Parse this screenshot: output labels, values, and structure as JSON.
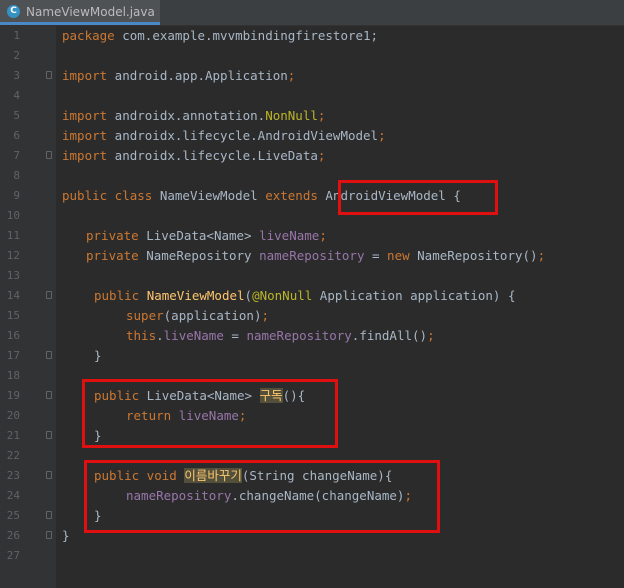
{
  "tab": {
    "icon_letter": "C",
    "label": "NameViewModel.java"
  },
  "lines": {
    "l1": {
      "num": "1",
      "a": "package",
      "b": " com.example.mvvmbindingfirestore1;"
    },
    "l2": {
      "num": "2"
    },
    "l3": {
      "num": "3",
      "a": "import",
      "b": " android.app.Application",
      "c": ";"
    },
    "l4": {
      "num": "4"
    },
    "l5": {
      "num": "5",
      "a": "import",
      "b": " androidx.annotation.",
      "c": "NonNull",
      "d": ";"
    },
    "l6": {
      "num": "6",
      "a": "import",
      "b": " androidx.lifecycle.AndroidViewModel",
      "c": ";"
    },
    "l7": {
      "num": "7",
      "a": "import",
      "b": " androidx.lifecycle.LiveData",
      "c": ";"
    },
    "l8": {
      "num": "8"
    },
    "l9": {
      "num": "9",
      "a": "public class",
      "b": " NameViewModel ",
      "c": "extends",
      "d": " AndroidViewModel {"
    },
    "l10": {
      "num": "10"
    },
    "l11": {
      "num": "11",
      "a": "private",
      "b": " LiveData<Name> ",
      "c": "liveName",
      "d": ";"
    },
    "l12": {
      "num": "12",
      "a": "private",
      "b": " NameRepository ",
      "c": "nameRepository",
      "d": " = ",
      "e": "new",
      "f": " NameRepository()",
      "g": ";"
    },
    "l13": {
      "num": "13"
    },
    "l14": {
      "num": "14",
      "a": "public",
      "b": " ",
      "c": "NameViewModel",
      "d": "(",
      "e": "@NonNull",
      "f": " Application application) {"
    },
    "l15": {
      "num": "15",
      "a": "super",
      "b": "(application)",
      "c": ";"
    },
    "l16": {
      "num": "16",
      "a": "this",
      "b": ".",
      "c": "liveName",
      "d": " = ",
      "e": "nameRepository",
      "f": ".findAll()",
      "g": ";"
    },
    "l17": {
      "num": "17",
      "a": "}"
    },
    "l18": {
      "num": "18"
    },
    "l19": {
      "num": "19",
      "a": "public",
      "b": " LiveData<Name> ",
      "c": "구독",
      "d": "(){"
    },
    "l20": {
      "num": "20",
      "a": "return",
      "b": " ",
      "c": "liveName",
      "d": ";"
    },
    "l21": {
      "num": "21",
      "a": "}"
    },
    "l22": {
      "num": "22"
    },
    "l23": {
      "num": "23",
      "a": "public void",
      "b": " ",
      "c": "이름바꾸기",
      "d": "(String changeName){"
    },
    "l24": {
      "num": "24",
      "a": "nameRepository",
      "b": ".changeName(changeName)",
      "c": ";"
    },
    "l25": {
      "num": "25",
      "a": "}"
    },
    "l26": {
      "num": "26",
      "a": "}"
    },
    "l27": {
      "num": "27"
    }
  }
}
